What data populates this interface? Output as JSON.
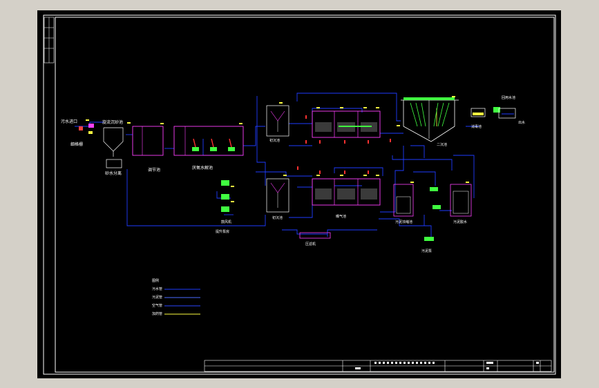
{
  "colors": {
    "sewage": "#1e3cff",
    "sludge": "#ff3030",
    "air": "#4a6cff",
    "chemical": "#ffff40",
    "tank": "#ff40ff",
    "equip": "#40ff40",
    "frame": "#ffffff",
    "background": "#000000",
    "chrome": "#d4d0c8"
  },
  "labels": {
    "inlet": "污水进口",
    "screen": "细格栅",
    "sand": "旋流沉砂池",
    "sand_sludge": "砂水分离",
    "regulating": "调节池",
    "hydrolysis": "厌氧水解池",
    "primary": "初沉池",
    "aeration": "曝气池",
    "secondary": "二沉池",
    "disinfect": "消毒池",
    "outlet": "出水",
    "sludge_tank": "污泥浓缩池",
    "dewater": "污泥脱水",
    "blower": "鼓风机",
    "pumphouse": "提升泵房",
    "sludge_pump": "污泥泵",
    "filter_press": "压滤机",
    "reuse": "回用水池"
  },
  "legend": {
    "title": "图例",
    "items": [
      {
        "label": "污水管",
        "color": "#1e3cff"
      },
      {
        "label": "污泥管",
        "color": "#4a6cff"
      },
      {
        "label": "空气管",
        "color": "#2a46ff"
      },
      {
        "label": "加药管",
        "color": "#ffff40"
      }
    ]
  }
}
